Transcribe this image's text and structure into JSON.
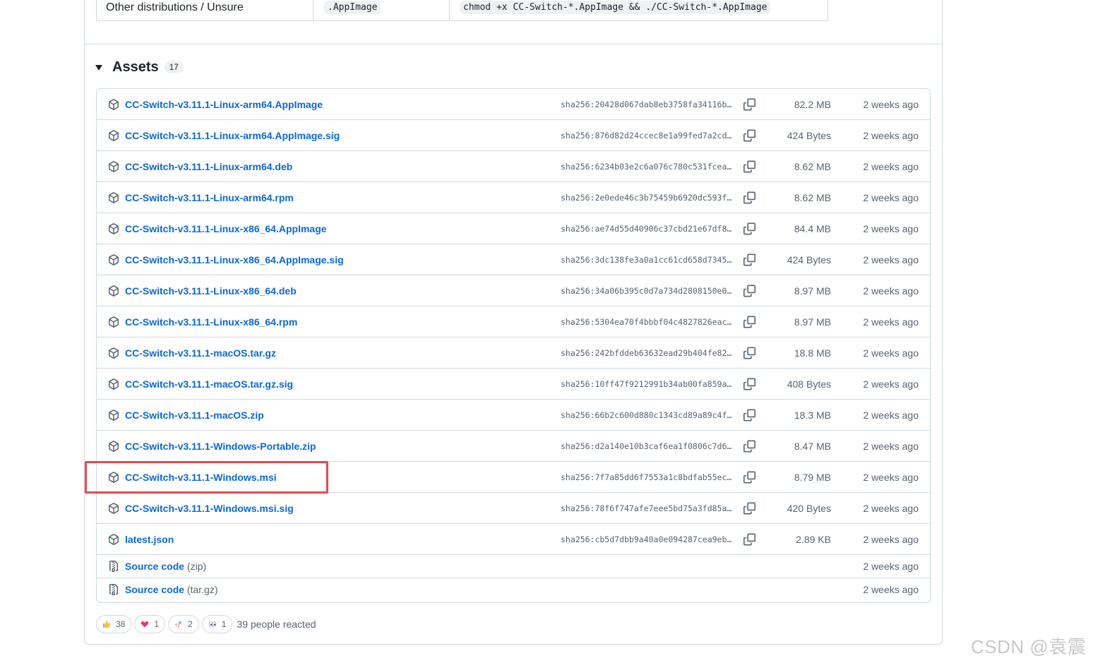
{
  "install_table": {
    "row": {
      "distro": "Other distributions / Unsure",
      "format": ".AppImage",
      "command": "chmod +x CC-Switch-*.AppImage && ./CC-Switch-*.AppImage"
    }
  },
  "assets": {
    "title": "Assets",
    "count": "17",
    "items": [
      {
        "name": "CC-Switch-v3.11.1-Linux-arm64.AppImage",
        "sha": "sha256:20428d067dab8eb3758fa34116b0e…",
        "size": "82.2 MB",
        "date": "2 weeks ago"
      },
      {
        "name": "CC-Switch-v3.11.1-Linux-arm64.AppImage.sig",
        "sha": "sha256:876d82d24ccec8e1a99fed7a2cd9d…",
        "size": "424 Bytes",
        "date": "2 weeks ago"
      },
      {
        "name": "CC-Switch-v3.11.1-Linux-arm64.deb",
        "sha": "sha256:6234b03e2c6a076c780c531fceaed…",
        "size": "8.62 MB",
        "date": "2 weeks ago"
      },
      {
        "name": "CC-Switch-v3.11.1-Linux-arm64.rpm",
        "sha": "sha256:2e0ede46c3b75459b6920dc593fdb…",
        "size": "8.62 MB",
        "date": "2 weeks ago"
      },
      {
        "name": "CC-Switch-v3.11.1-Linux-x86_64.AppImage",
        "sha": "sha256:ae74d55d40906c37cbd21e67df8b5…",
        "size": "84.4 MB",
        "date": "2 weeks ago"
      },
      {
        "name": "CC-Switch-v3.11.1-Linux-x86_64.AppImage.sig",
        "sha": "sha256:3dc138fe3a0a1cc61cd658d7345a0…",
        "size": "424 Bytes",
        "date": "2 weeks ago"
      },
      {
        "name": "CC-Switch-v3.11.1-Linux-x86_64.deb",
        "sha": "sha256:34a06b395c0d7a734d2808150e060…",
        "size": "8.97 MB",
        "date": "2 weeks ago"
      },
      {
        "name": "CC-Switch-v3.11.1-Linux-x86_64.rpm",
        "sha": "sha256:5304ea70f4bbbf04c4827826eacc8…",
        "size": "8.97 MB",
        "date": "2 weeks ago"
      },
      {
        "name": "CC-Switch-v3.11.1-macOS.tar.gz",
        "sha": "sha256:242bfddeb63632ead29b404fe827b…",
        "size": "18.8 MB",
        "date": "2 weeks ago"
      },
      {
        "name": "CC-Switch-v3.11.1-macOS.tar.gz.sig",
        "sha": "sha256:10ff47f9212991b34ab00fa859a95…",
        "size": "408 Bytes",
        "date": "2 weeks ago"
      },
      {
        "name": "CC-Switch-v3.11.1-macOS.zip",
        "sha": "sha256:66b2c600d880c1343cd89a89c4ffb…",
        "size": "18.3 MB",
        "date": "2 weeks ago"
      },
      {
        "name": "CC-Switch-v3.11.1-Windows-Portable.zip",
        "sha": "sha256:d2a140e10b3caf6ea1f0806c7d68e…",
        "size": "8.47 MB",
        "date": "2 weeks ago"
      },
      {
        "name": "CC-Switch-v3.11.1-Windows.msi",
        "sha": "sha256:7f7a85dd6f7553a1c8bdfab55ec2a…",
        "size": "8.79 MB",
        "date": "2 weeks ago"
      },
      {
        "name": "CC-Switch-v3.11.1-Windows.msi.sig",
        "sha": "sha256:78f6f747afe7eee5bd75a3fd85a4b…",
        "size": "420 Bytes",
        "date": "2 weeks ago"
      },
      {
        "name": "latest.json",
        "sha": "sha256:cb5d7dbb9a40a0e094287cea9eb27…",
        "size": "2.89 KB",
        "date": "2 weeks ago"
      }
    ],
    "source": [
      {
        "label": "Source code",
        "suffix": "(zip)",
        "date": "2 weeks ago"
      },
      {
        "label": "Source code",
        "suffix": "(tar.gz)",
        "date": "2 weeks ago"
      }
    ]
  },
  "reactions": {
    "items": [
      {
        "emoji": "thumbs-up",
        "count": "38"
      },
      {
        "emoji": "heart",
        "count": "1"
      },
      {
        "emoji": "rocket",
        "count": "2"
      },
      {
        "emoji": "eyes",
        "count": "1"
      }
    ],
    "summary": "39 people reacted"
  },
  "watermark": "CSDN @袁震",
  "colors": {
    "link": "#0969da",
    "muted": "#59636e",
    "border": "#d1d9e0",
    "highlight": "#e8494e"
  }
}
